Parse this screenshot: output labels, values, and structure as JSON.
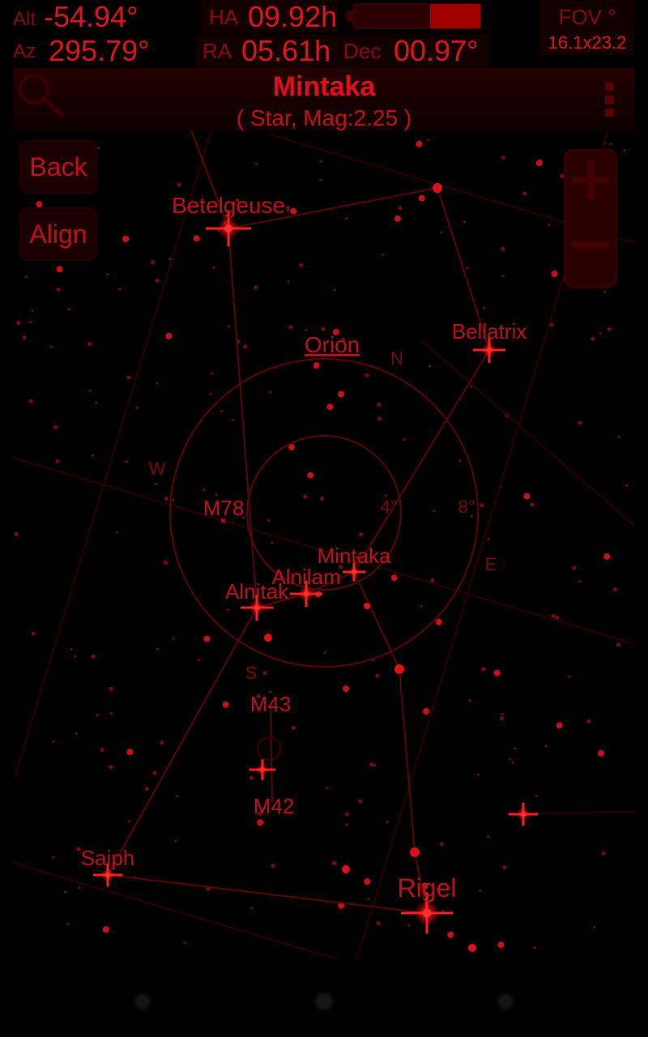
{
  "hud": {
    "alt_label": "Alt",
    "alt_value": "-54.94°",
    "az_label": "Az",
    "az_value": "295.79°",
    "ha_label": "HA",
    "ha_value": "09.92h",
    "ra_label": "RA",
    "ra_value": "05.61h",
    "dec_label": "Dec",
    "dec_value": "00.97°",
    "fov_label": "FOV °",
    "fov_value": "16.1x23.2",
    "battery_level": 0.4
  },
  "object": {
    "name": "Mintaka",
    "subtitle": "( Star, Mag:2.25 )"
  },
  "buttons": {
    "back": "Back",
    "align": "Align"
  },
  "sky_labels": {
    "constellation": "Orion",
    "betelgeuse": "Betelgeuse",
    "bellatrix": "Bellatrix",
    "mintaka": "Mintaka",
    "alnilam": "Alnilam",
    "alnitak": "Alnitak",
    "saiph": "Saiph",
    "rigel": "Rigel",
    "m78": "M78",
    "m43": "M43",
    "m42": "M42",
    "north": "N",
    "south": "S",
    "east": "E",
    "west": "W",
    "ring_inner": "4°",
    "ring_outer": "8°"
  },
  "colors": {
    "accent": "#e2141d",
    "dim": "#8a0a0f",
    "background": "#000000"
  },
  "icons": [
    "search-icon",
    "overflow-menu-icon",
    "zoom-in-icon",
    "zoom-out-icon"
  ]
}
